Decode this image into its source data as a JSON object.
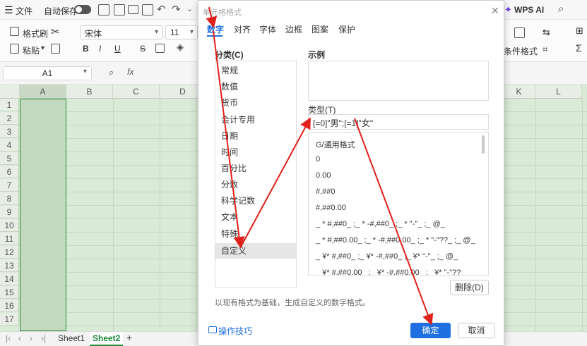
{
  "topbar": {
    "menu_label": "文件",
    "autosave_label": "自动保存",
    "wps_ai_label": "WPS AI"
  },
  "ribbon": {
    "format_painter_label": "格式刷",
    "paste_label": "粘贴",
    "font_name": "宋体",
    "font_size": "11",
    "bold": "B",
    "italic": "I",
    "underline": "U",
    "strike": "S",
    "cond_format_label": "条件格式",
    "sigma": "Σ"
  },
  "formula_bar": {
    "cell_ref": "A1",
    "fx": "fx"
  },
  "grid": {
    "columns": [
      "A",
      "B",
      "C",
      "D",
      "K",
      "L"
    ],
    "rows": [
      "1",
      "2",
      "3",
      "4",
      "5",
      "6",
      "7",
      "8",
      "9",
      "10",
      "11",
      "12",
      "13",
      "14",
      "15",
      "16",
      "17"
    ]
  },
  "sheets": {
    "tabs": [
      "Sheet1",
      "Sheet2"
    ],
    "active": "Sheet2",
    "add": "+"
  },
  "dialog": {
    "title": "单元格格式",
    "tabs": [
      "数字",
      "对齐",
      "字体",
      "边框",
      "图案",
      "保护"
    ],
    "category_label": "分类(C)",
    "categories": [
      "常规",
      "数值",
      "货币",
      "会计专用",
      "日期",
      "时间",
      "百分比",
      "分数",
      "科学记数",
      "文本",
      "特殊",
      "自定义"
    ],
    "selected_category": "自定义",
    "example_label": "示例",
    "type_label": "类型(T)",
    "type_value": "[=0]\"男\";[=1]\"女\"",
    "type_list": [
      "G/通用格式",
      "0",
      "0.00",
      "#,##0",
      "#,##0.00",
      "_ * #,##0_ ;_ * -#,##0_ ;_ * \"-\"_ ;_ @_",
      "_ * #,##0.00_ ;_ * -#,##0.00_ ;_ * \"-\"??_ ;_ @_",
      "_ ¥* #,##0_ ;_ ¥* -#,##0_ ;_ ¥* \"-\"_ ;_ @_",
      "_ ¥* #,##0.00_ ;_ ¥* -#,##0.00_ ;_ ¥* \"-\"??"
    ],
    "delete_label": "删除(D)",
    "hint": "以现有格式为基础，生成自定义的数字格式。",
    "tips_label": "操作技巧",
    "ok_label": "确定",
    "cancel_label": "取消"
  },
  "colors": {
    "accent": "#1f6fe0",
    "grid_bg": "#d9ead6",
    "annotation": "#e0201a"
  }
}
